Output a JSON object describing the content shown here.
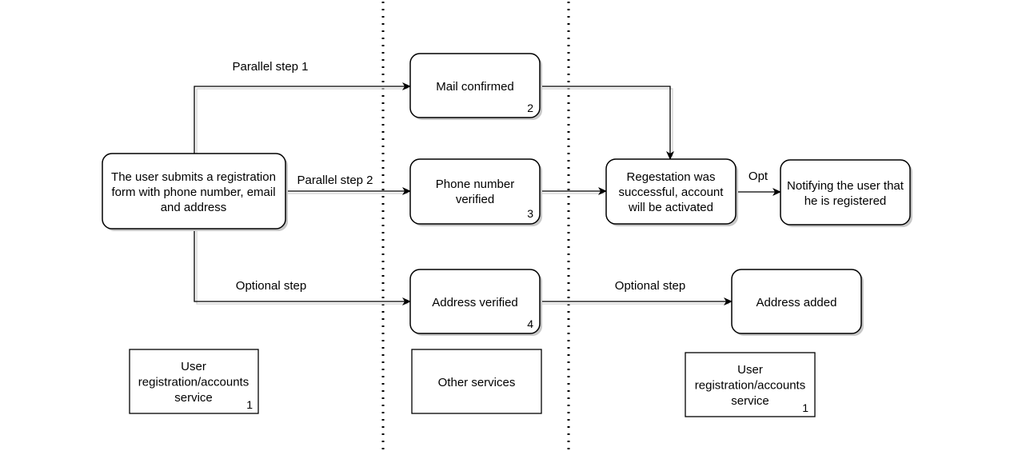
{
  "colors": {
    "stroke": "#000000",
    "background": "#ffffff",
    "shadow": "#c8c8c8"
  },
  "nodes": {
    "submit": {
      "lines": [
        "The user submits a registration",
        "form with phone number, email",
        "and address"
      ]
    },
    "mail": {
      "lines": [
        "Mail confirmed"
      ],
      "number": "2"
    },
    "phone": {
      "lines": [
        "Phone number",
        "verified"
      ],
      "number": "3"
    },
    "address_verified": {
      "lines": [
        "Address verified"
      ],
      "number": "4"
    },
    "registration": {
      "lines": [
        "Regestation was",
        "successful, account",
        "will be activated"
      ]
    },
    "notify": {
      "lines": [
        "Notifying the user that",
        "he is registered"
      ]
    },
    "address_added": {
      "lines": [
        "Address added"
      ]
    }
  },
  "lanes": {
    "left": {
      "lines": [
        "User",
        "registration/accounts",
        "service"
      ],
      "number": "1"
    },
    "middle": {
      "lines": [
        "Other services"
      ]
    },
    "right": {
      "lines": [
        "User",
        "registration/accounts",
        "service"
      ],
      "number": "1"
    }
  },
  "edges": {
    "parallel1": "Parallel step 1",
    "parallel2": "Parallel step 2",
    "optional1": "Optional step",
    "opt": "Opt",
    "optional2": "Optional step"
  }
}
